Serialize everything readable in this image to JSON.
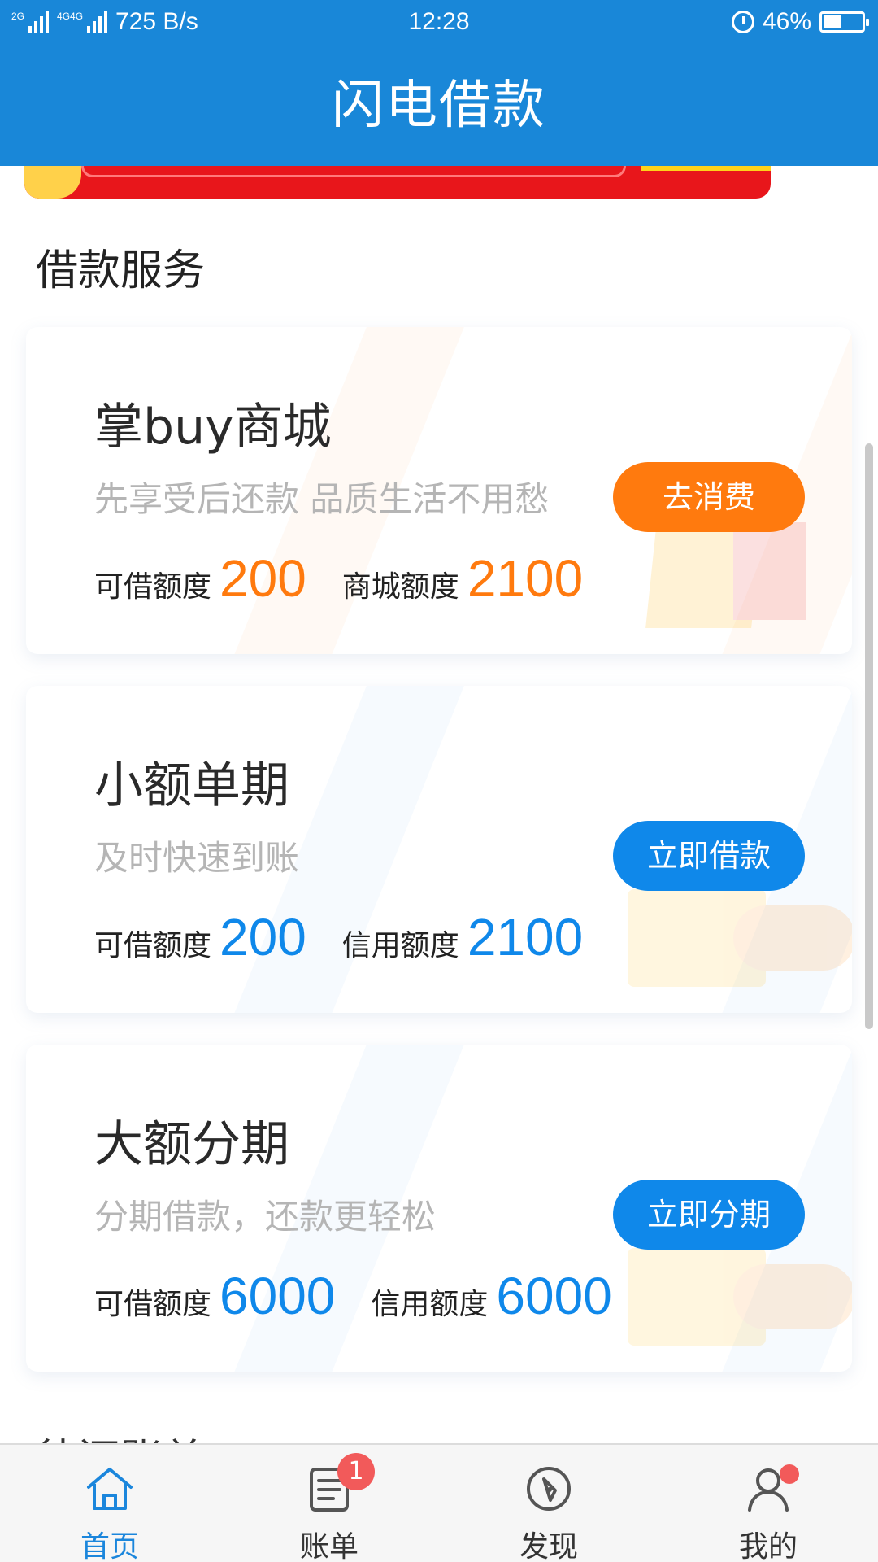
{
  "status_bar": {
    "network": "2G",
    "network2": "4G4G",
    "speed": "725 B/s",
    "time": "12:28",
    "battery": "46%",
    "battery_level": 0.46
  },
  "header": {
    "title": "闪电借款"
  },
  "section_title": "借款服务",
  "cards": [
    {
      "title": "掌buy商城",
      "desc": "先享受后还款 品质生活不用愁",
      "button": "去消费",
      "stat1_label": "可借额度",
      "stat1_value": "200",
      "stat2_label": "商城额度",
      "stat2_value": "2100",
      "accent": "#ff7a0e"
    },
    {
      "title": "小额单期",
      "desc": "及时快速到账",
      "button": "立即借款",
      "stat1_label": "可借额度",
      "stat1_value": "200",
      "stat2_label": "信用额度",
      "stat2_value": "2100",
      "accent": "#0f88ea"
    },
    {
      "title": "大额分期",
      "desc": "分期借款，还款更轻松",
      "button": "立即分期",
      "stat1_label": "可借额度",
      "stat1_value": "6000",
      "stat2_label": "信用额度",
      "stat2_value": "6000",
      "accent": "#0f88ea"
    }
  ],
  "peek_title": "待还账单",
  "tabs": [
    {
      "label": "首页",
      "icon": "home-icon",
      "active": true
    },
    {
      "label": "账单",
      "icon": "bill-icon",
      "badge": "1"
    },
    {
      "label": "发现",
      "icon": "compass-icon"
    },
    {
      "label": "我的",
      "icon": "user-icon",
      "dot": true
    }
  ],
  "colors": {
    "primary": "#1987d8",
    "orange": "#ff7a0e",
    "blue": "#0f88ea",
    "badge": "#f25a5a"
  }
}
